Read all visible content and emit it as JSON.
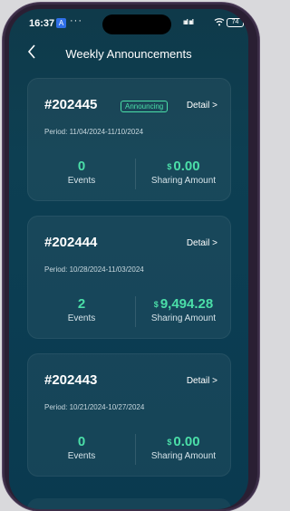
{
  "status_bar": {
    "time": "16:37",
    "notification_glyph": "A",
    "more": "···",
    "signal": "ıııl ıııl",
    "battery": "74"
  },
  "header": {
    "title": "Weekly Announcements"
  },
  "cards": [
    {
      "id": "#202445",
      "badge": "Announcing",
      "detail": "Detail >",
      "period": "Period: 11/04/2024-11/10/2024",
      "events_value": "0",
      "events_label": "Events",
      "currency": "$",
      "amount": "0.00",
      "amount_label": "Sharing Amount"
    },
    {
      "id": "#202444",
      "badge": "",
      "detail": "Detail >",
      "period": "Period: 10/28/2024-11/03/2024",
      "events_value": "2",
      "events_label": "Events",
      "currency": "$",
      "amount": "9,494.28",
      "amount_label": "Sharing Amount"
    },
    {
      "id": "#202443",
      "badge": "",
      "detail": "Detail >",
      "period": "Period: 10/21/2024-10/27/2024",
      "events_value": "0",
      "events_label": "Events",
      "currency": "$",
      "amount": "0.00",
      "amount_label": "Sharing Amount"
    }
  ],
  "colors": {
    "accent": "#4bdfa8",
    "background": "#0d3f52"
  }
}
